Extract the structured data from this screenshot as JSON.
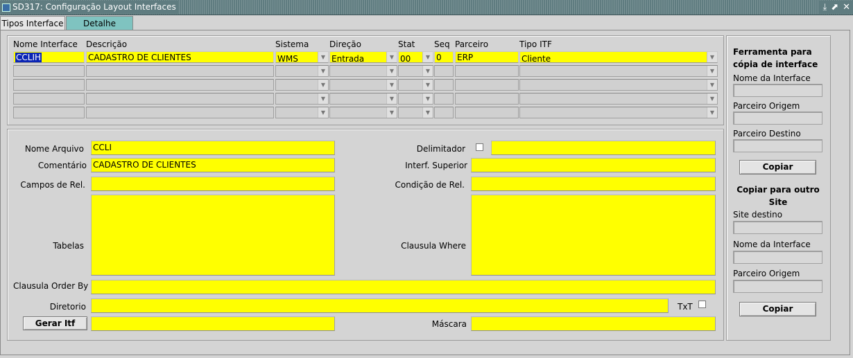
{
  "window": {
    "title": "SD317: Configuração Layout Interfaces",
    "controls": [
      "⤓",
      "⬈",
      "✕"
    ]
  },
  "tabs": [
    {
      "label": "Tipos Interface"
    },
    {
      "label": "Detalhe"
    }
  ],
  "grid": {
    "headers": {
      "nome_interface": "Nome Interface",
      "descricao": "Descrição",
      "sistema": "Sistema",
      "direcao": "Direção",
      "stat": "Stat",
      "seq": "Seq",
      "parceiro": "Parceiro",
      "tipo_itf": "Tipo ITF"
    },
    "row1": {
      "nome_interface": "CCLIH",
      "descricao": "CADASTRO DE CLIENTES",
      "sistema": "WMS",
      "direcao": "Entrada",
      "stat": "00",
      "seq": "0",
      "parceiro": "ERP",
      "tipo_itf": "Cliente"
    }
  },
  "detail": {
    "nome_arquivo": {
      "label": "Nome Arquivo",
      "value": "CCLI"
    },
    "comentario": {
      "label": "Comentário",
      "value": "CADASTRO DE CLIENTES"
    },
    "campos_rel": {
      "label": "Campos de Rel.",
      "value": ""
    },
    "tabelas": {
      "label": "Tabelas",
      "value": ""
    },
    "clausula_order_by": {
      "label": "Clausula Order By",
      "value": ""
    },
    "diretorio": {
      "label": "Diretorio",
      "value": ""
    },
    "gerar_itf": {
      "label": "Gerar Itf",
      "value": ""
    },
    "delimitador": {
      "label": "Delimitador",
      "value": ""
    },
    "interf_superior": {
      "label": "Interf. Superior",
      "value": ""
    },
    "condicao_rel": {
      "label": "Condição de Rel.",
      "value": ""
    },
    "clausula_where": {
      "label": "Clausula Where",
      "value": ""
    },
    "txt": {
      "label": "TxT"
    },
    "mascara": {
      "label": "Máscara",
      "value": ""
    }
  },
  "side": {
    "copy_tool_title": "Ferramenta para cópia de interface",
    "nome_interface": "Nome da Interface",
    "parceiro_origem": "Parceiro Origem",
    "parceiro_destino": "Parceiro Destino",
    "copiar1": "Copiar",
    "copy_site_title": "Copiar para outro Site",
    "site_destino": "Site destino",
    "nome_interface2": "Nome da Interface",
    "parceiro_origem2": "Parceiro Origem",
    "copiar2": "Copiar"
  },
  "colors": {
    "field_active": "#ffff00",
    "titlebar": "#5f7c80",
    "tab_active": "#7fc3c0"
  }
}
